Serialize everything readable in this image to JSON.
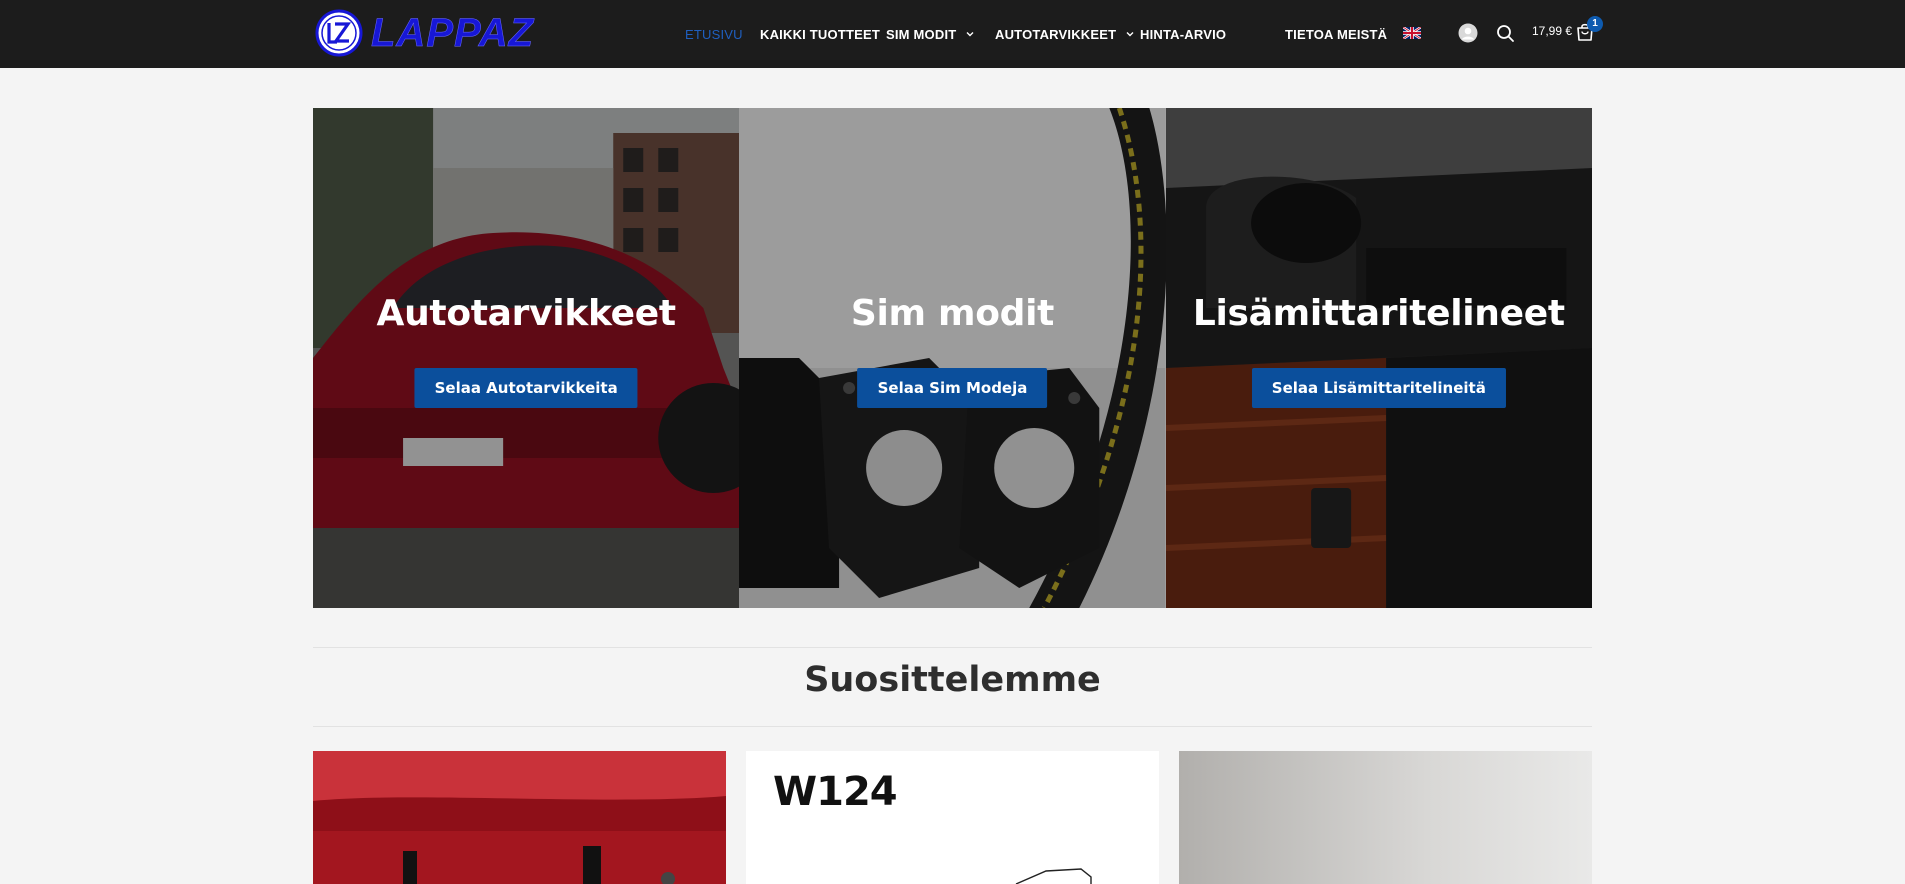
{
  "brand": {
    "name": "LAPPAZ",
    "logo_letters": "LZ",
    "color": "#1717d6"
  },
  "nav": {
    "items": [
      {
        "label": "ETUSIVU",
        "active": true
      },
      {
        "label": "KAIKKI TUOTTEET"
      },
      {
        "label": "SIM MODIT",
        "dropdown": true
      },
      {
        "label": "AUTOTARVIKKEET",
        "dropdown": true
      },
      {
        "label": "HINTA-ARVIO"
      },
      {
        "label": "TIETOA MEISTÄ"
      }
    ],
    "language_flag": "uk-flag-icon"
  },
  "header_icons": [
    "account-icon",
    "search-icon",
    "cart-icon"
  ],
  "cart": {
    "total": "17,99 €",
    "count": "1"
  },
  "hero": {
    "panels": [
      {
        "title": "Autotarvikkeet",
        "button": "Selaa Autotarvikkeita"
      },
      {
        "title": "Sim modit",
        "button": "Selaa Sim Modeja"
      },
      {
        "title": "Lisämittaritelineet",
        "button": "Selaa Lisämittaritelineitä"
      }
    ]
  },
  "recommended": {
    "title": "Suosittelemme",
    "products": [
      {
        "image_text": ""
      },
      {
        "image_text": "W124"
      },
      {
        "image_text": ""
      }
    ]
  },
  "colors": {
    "header_bg": "#1c1c1c",
    "accent": "#0b4f9c",
    "active_nav": "#1f5fbf",
    "page_bg": "#f4f4f4"
  }
}
